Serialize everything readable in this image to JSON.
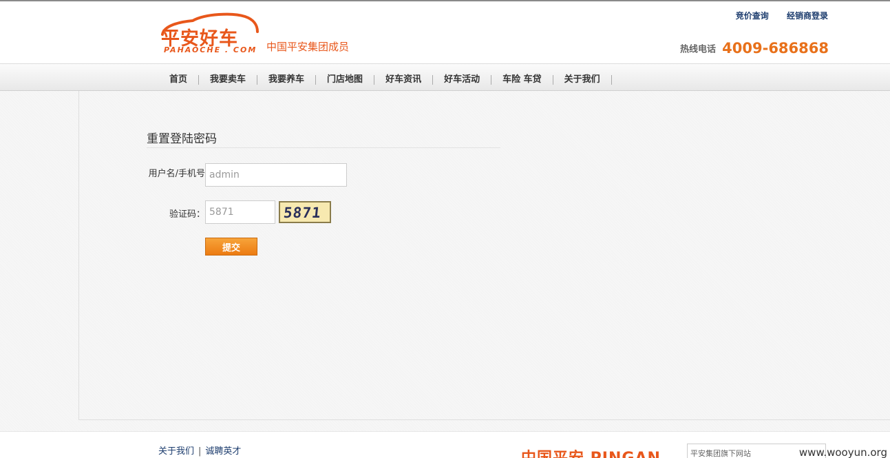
{
  "brand": {
    "logo_cn": "平安好车",
    "logo_en": "PAHAOCHE . COM",
    "slogan": "中国平安集团成员",
    "color": "#e8571b"
  },
  "top_links": [
    "竞价查询",
    "经销商登录"
  ],
  "hotline": {
    "label": "热线电话",
    "number": "4009-686868"
  },
  "nav": [
    "首页",
    "我要卖车",
    "我要养车",
    "门店地图",
    "好车资讯",
    "好车活动",
    "车险 车贷",
    "关于我们"
  ],
  "form": {
    "title": "重置登陆密码",
    "username_label": "用户名/手机号",
    "username_value": "admin",
    "code_label": "验证码：",
    "code_value": "5871",
    "captcha_text": "5871",
    "submit_label": "提交",
    "submit_color": "#ec7b12"
  },
  "footer": {
    "links": [
      "关于我们",
      "诚聘英才"
    ],
    "separator": "|",
    "partner_logo": "中国平安 PINGAN",
    "site_select": "平安集团旗下网站",
    "watermark": "www.wooyun.org"
  }
}
